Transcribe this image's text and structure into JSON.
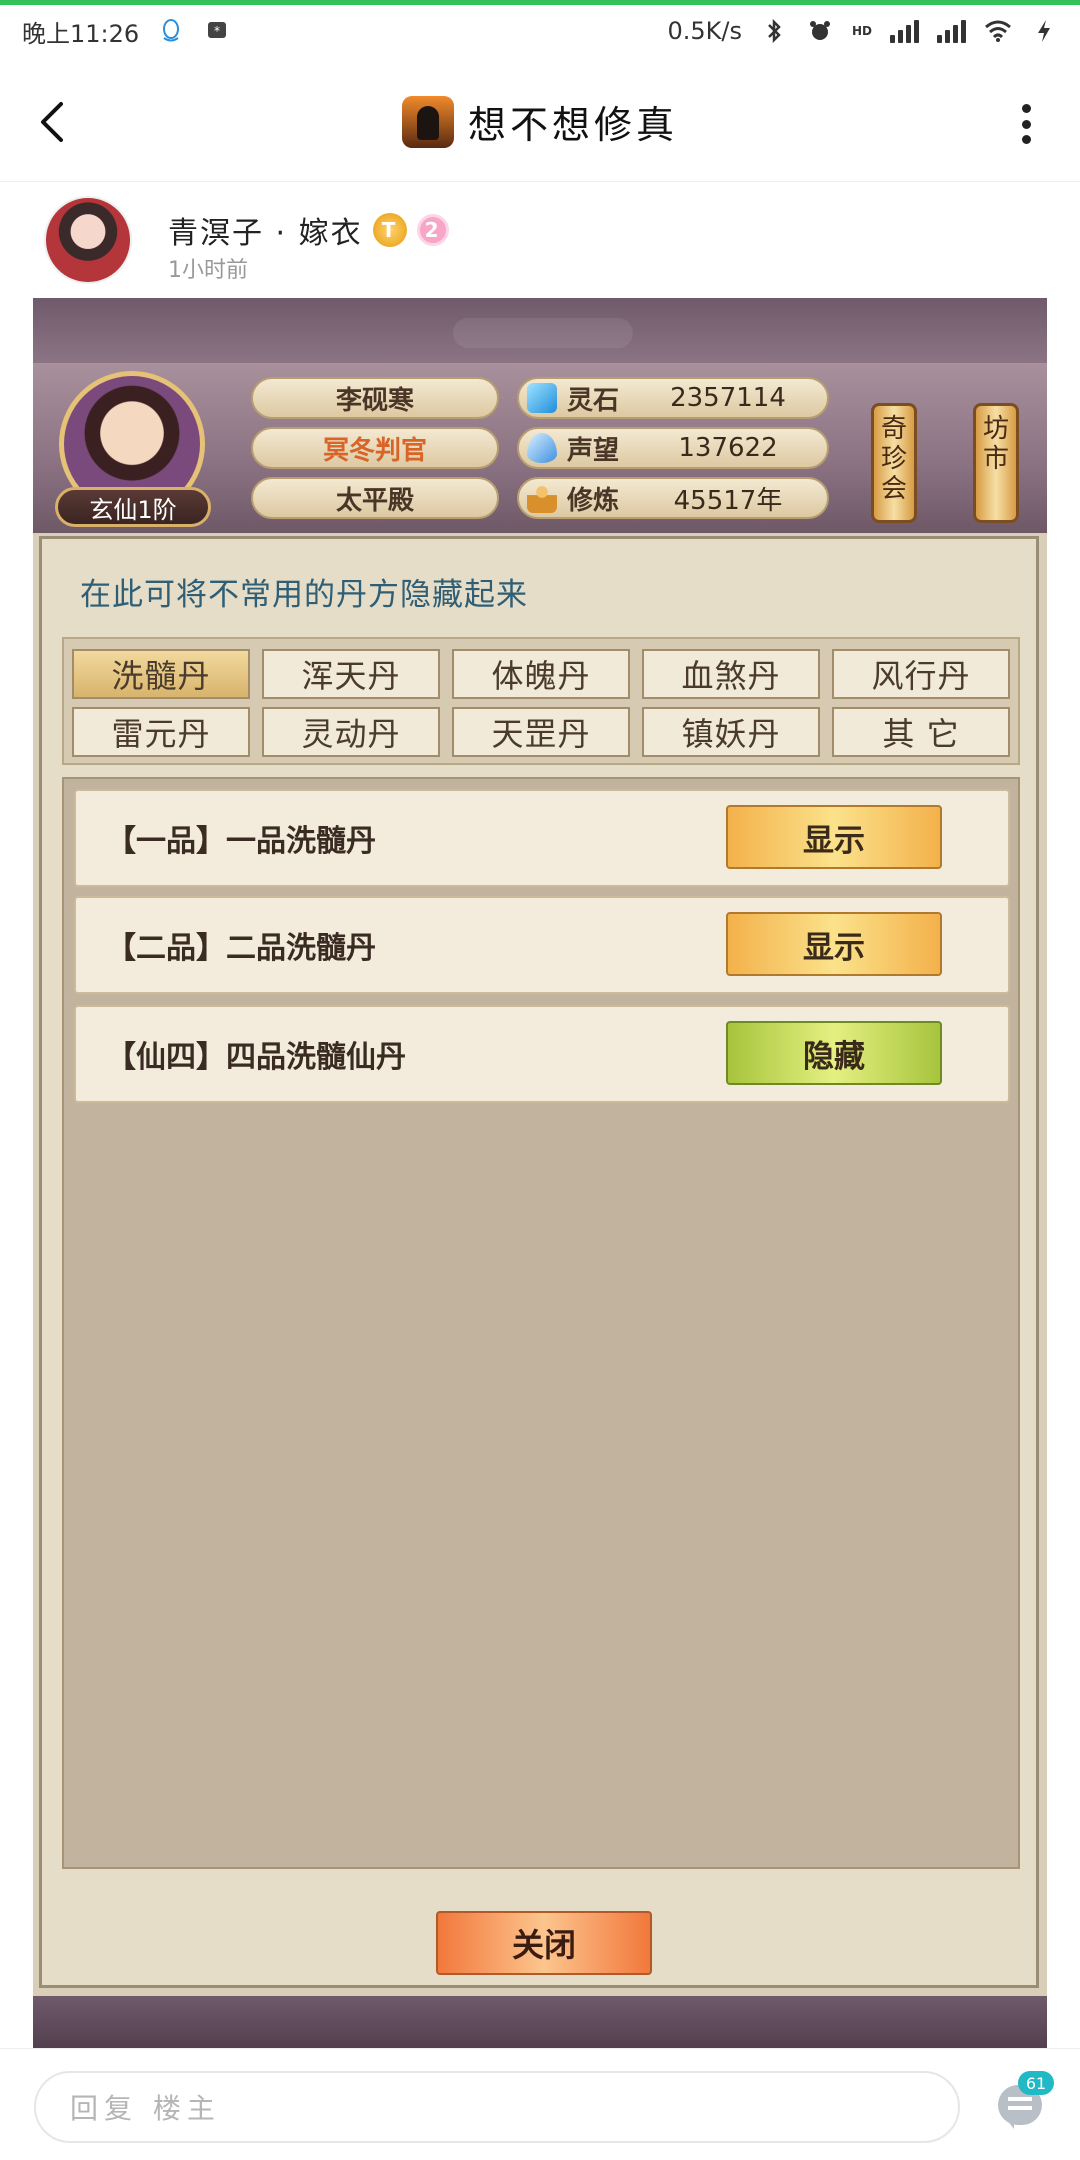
{
  "status_bar": {
    "time": "晚上11:26",
    "net_speed": "0.5K/s",
    "network_type": "HD"
  },
  "header": {
    "title": "想不想修真"
  },
  "post": {
    "author": "青溟子 · 嫁衣",
    "badge_t": "T",
    "level": "2",
    "time_ago": "1小时前"
  },
  "game": {
    "player": {
      "name": "李砚寒",
      "title": "冥冬判官",
      "sect": "太平殿",
      "rank": "玄仙1阶"
    },
    "stats": [
      {
        "label": "灵石",
        "value": "2357114",
        "icon": "spirit-stone-icon",
        "color": "#2fa5e8"
      },
      {
        "label": "声望",
        "value": "137622",
        "icon": "reputation-crystal-icon",
        "color": "#4aa0e6"
      },
      {
        "label": "修炼",
        "value": "45517年",
        "icon": "meditation-icon",
        "color": "#d8902c"
      }
    ],
    "shops": [
      "奇珍会",
      "坊市"
    ],
    "hint": "在此可将不常用的丹方隐藏起来",
    "tabs": [
      "洗髓丹",
      "浑天丹",
      "体魄丹",
      "血煞丹",
      "风行丹",
      "雷元丹",
      "灵动丹",
      "天罡丹",
      "镇妖丹",
      "其 它"
    ],
    "active_tab": "洗髓丹",
    "recipes": [
      {
        "label": "【一品】一品洗髓丹",
        "action": "显示",
        "state": "show"
      },
      {
        "label": "【二品】二品洗髓丹",
        "action": "显示",
        "state": "show"
      },
      {
        "label": "【仙四】四品洗髓仙丹",
        "action": "隐藏",
        "state": "hide"
      }
    ],
    "close_label": "关闭"
  },
  "reply_bar": {
    "placeholder": "回复 楼主",
    "comment_count": "61"
  }
}
